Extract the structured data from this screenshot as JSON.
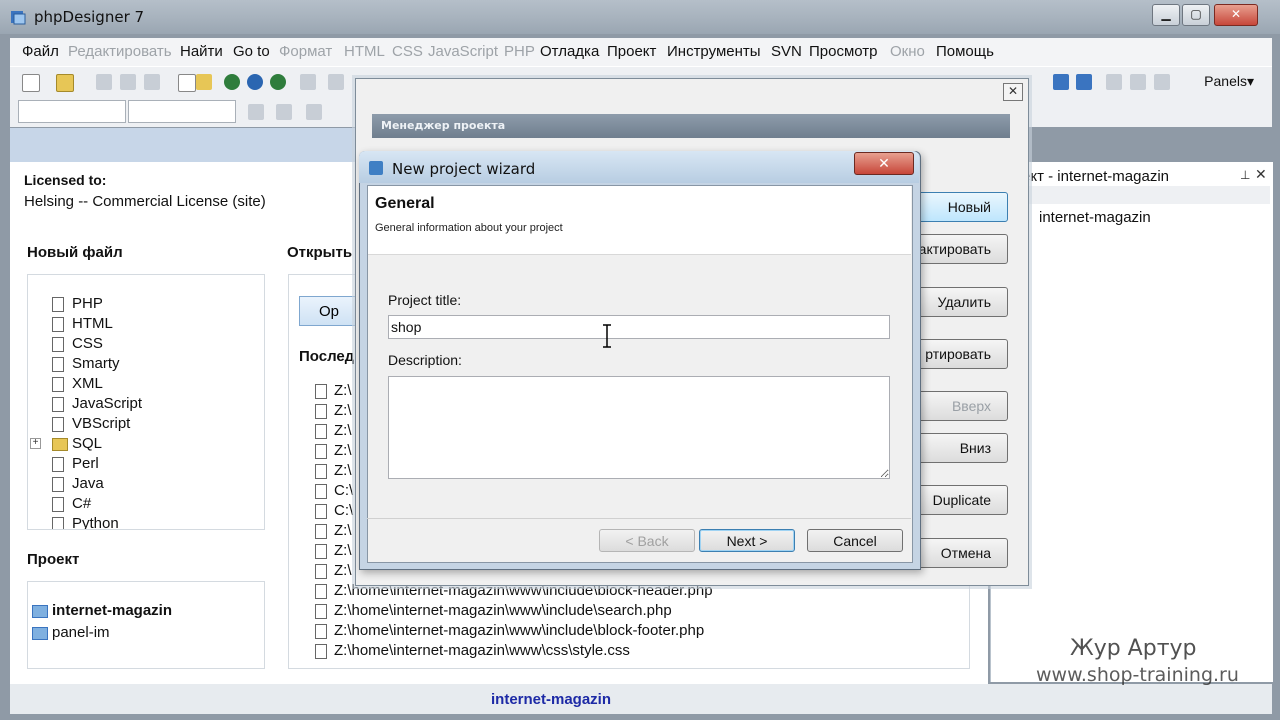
{
  "window": {
    "title": "phpDesigner 7",
    "minimize": "▁",
    "maximize": "▢",
    "close": "✕"
  },
  "menu": [
    {
      "label": "Файл",
      "enabled": true
    },
    {
      "label": "Редактировать",
      "enabled": false
    },
    {
      "label": "Найти",
      "enabled": true
    },
    {
      "label": "Go to",
      "enabled": true
    },
    {
      "label": "Формат",
      "enabled": false
    },
    {
      "label": "HTML",
      "enabled": false
    },
    {
      "label": "CSS",
      "enabled": false
    },
    {
      "label": "JavaScript",
      "enabled": false
    },
    {
      "label": "PHP",
      "enabled": false
    },
    {
      "label": "Отладка",
      "enabled": true
    },
    {
      "label": "Проект",
      "enabled": true
    },
    {
      "label": "Инструменты",
      "enabled": true
    },
    {
      "label": "SVN",
      "enabled": true
    },
    {
      "label": "Просмотр",
      "enabled": true
    },
    {
      "label": "Окно",
      "enabled": false
    },
    {
      "label": "Помощь",
      "enabled": true
    }
  ],
  "toolbar": {
    "panels_label": "Panels▾"
  },
  "license": {
    "label": "Licensed to:",
    "value": "Helsing -- Commercial License (site)"
  },
  "new_file": {
    "title": "Новый файл",
    "items": [
      "PHP",
      "HTML",
      "CSS",
      "Smarty",
      "XML",
      "JavaScript",
      "VBScript",
      "SQL",
      "Perl",
      "Java",
      "C#",
      "Python"
    ]
  },
  "open": {
    "title": "Открыть",
    "button_label": "Op"
  },
  "recent": {
    "title": "Послед",
    "items": [
      "Z:\\",
      "Z:\\",
      "Z:\\",
      "Z:\\",
      "Z:\\",
      "C:\\",
      "C:\\",
      "Z:\\",
      "Z:\\",
      "Z:\\",
      "Z:\\home\\internet-magazin\\www\\include\\block-header.php",
      "Z:\\home\\internet-magazin\\www\\include\\search.php",
      "Z:\\home\\internet-magazin\\www\\include\\block-footer.php",
      "Z:\\home\\internet-magazin\\www\\css\\style.css"
    ]
  },
  "project": {
    "title": "Проект",
    "items": [
      "internet-magazin",
      "panel-im"
    ]
  },
  "status": {
    "text": "internet-magazin"
  },
  "right_panel": {
    "title": "ект - internet-magazin",
    "tree_item": "internet-magazin"
  },
  "project_manager": {
    "header": "Менеджер проекта",
    "buttons": [
      {
        "label": "Новый",
        "enabled": true
      },
      {
        "label": "актировать",
        "enabled": true
      },
      {
        "label": "Удалить",
        "enabled": true
      },
      {
        "label": "ртировать",
        "enabled": true
      },
      {
        "label": "Вверх",
        "enabled": false
      },
      {
        "label": "Вниз",
        "enabled": true
      },
      {
        "label": "Duplicate",
        "enabled": true
      },
      {
        "label": "Отмена",
        "enabled": true
      }
    ]
  },
  "wizard": {
    "title": "New project wizard",
    "section_title": "General",
    "section_subtitle": "General information about your project",
    "project_title_label": "Project title:",
    "project_title_value": "shop",
    "description_label": "Description:",
    "description_value": "",
    "back_label": "< Back",
    "next_label": "Next >",
    "cancel_label": "Cancel"
  },
  "watermark": {
    "line1": "Жур Артур",
    "line2": "www.shop-training.ru"
  }
}
